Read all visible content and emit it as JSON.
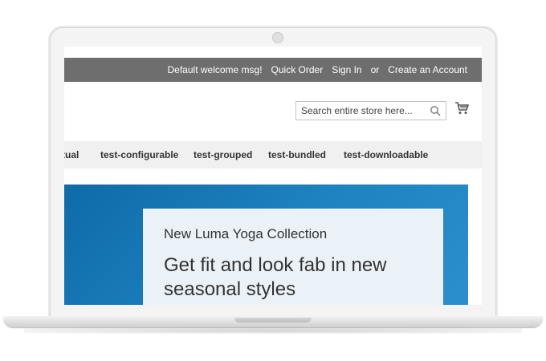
{
  "header": {
    "welcome": "Default welcome msg!",
    "quick_order": "Quick Order",
    "sign_in": "Sign In",
    "or": "or",
    "create_account": "Create an Account"
  },
  "search": {
    "placeholder": "Search entire store here...",
    "icon": "search-icon"
  },
  "cart": {
    "icon": "cart-icon"
  },
  "nav": {
    "items": [
      {
        "label": "tual"
      },
      {
        "label": "test-configurable"
      },
      {
        "label": "test-grouped"
      },
      {
        "label": "test-bundled"
      },
      {
        "label": "test-downloadable"
      }
    ]
  },
  "hero": {
    "subtitle": "New Luma Yoga Collection",
    "title_line1": "Get fit and look fab in new",
    "title_line2": "seasonal styles"
  },
  "colors": {
    "topbar": "#6e6e6e",
    "nav_bg": "#f0f0f0",
    "hero_blue": "#1f83c2",
    "hero_card": "#eaf2f8"
  }
}
